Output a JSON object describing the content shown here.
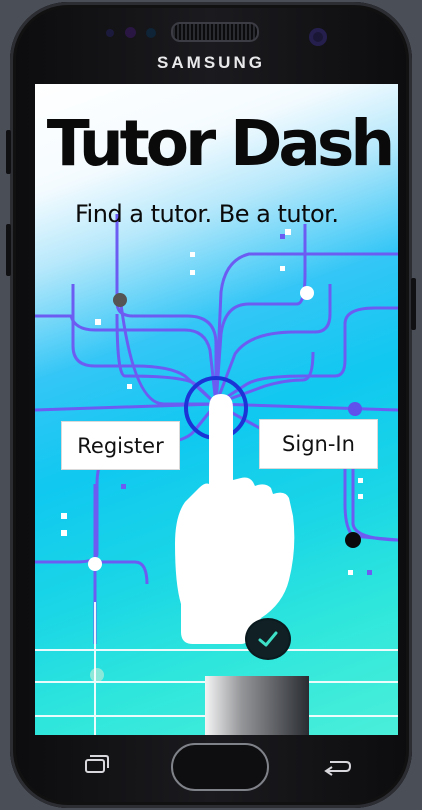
{
  "device": {
    "brand": "SAMSUNG"
  },
  "app": {
    "title": "Tutor Dash",
    "tagline": "Find a tutor. Be a tutor.",
    "register_label": "Register",
    "signin_label": "Sign-In"
  },
  "icons": {
    "check": "check-icon",
    "recent_apps": "recent-apps-icon",
    "home": "home-button",
    "back": "back-icon"
  },
  "colors": {
    "line": "#6c5cf2",
    "circle_ring": "#1a34d6",
    "sky_top": "#ffffff",
    "sea_bottom": "#4aefd9"
  }
}
